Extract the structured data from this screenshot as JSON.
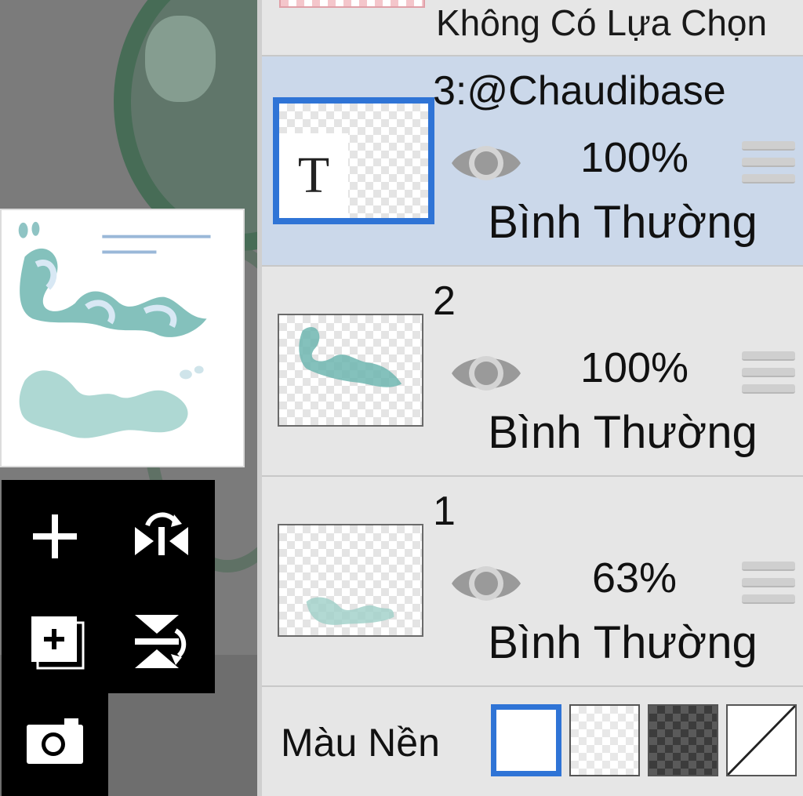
{
  "selection": {
    "label": "Không Có Lựa Chọn"
  },
  "layers": [
    {
      "name": "3:@Chaudibase",
      "opacity": "100%",
      "blend": "Bình Thường",
      "active": true,
      "type": "text",
      "thumb_letter": "T"
    },
    {
      "name": "2",
      "opacity": "100%",
      "blend": "Bình Thường",
      "active": false,
      "type": "image"
    },
    {
      "name": "1",
      "opacity": "63%",
      "blend": "Bình Thường",
      "active": false,
      "type": "image"
    }
  ],
  "background": {
    "label": "Màu Nền",
    "options": [
      "white",
      "transparent-light",
      "transparent-dark",
      "none"
    ],
    "selected": "white"
  },
  "tools": [
    "add-layer",
    "flip-horizontal",
    "duplicate-layer",
    "flip-vertical",
    "camera"
  ],
  "colors": {
    "accent": "#2f74d6",
    "active_row": "#cbd8ea",
    "panel_bg": "#e6e6e6"
  }
}
